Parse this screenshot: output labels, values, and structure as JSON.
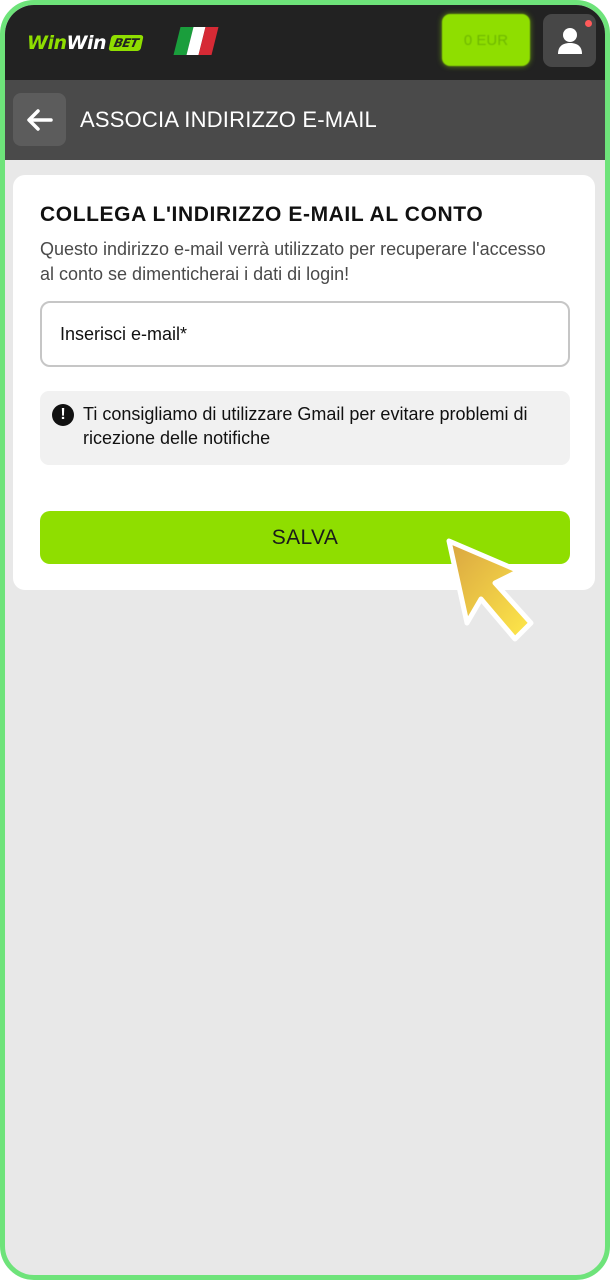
{
  "header": {
    "logo": {
      "part1": "Win",
      "part2": "Win",
      "badge": "BET"
    },
    "balance_label": "0 EUR",
    "flag_colors": [
      "#1a9e3c",
      "#ffffff",
      "#d62a35"
    ],
    "accent_color": "#8fde00"
  },
  "subheader": {
    "title": "ASSOCIA INDIRIZZO E-MAIL"
  },
  "card": {
    "title": "COLLEGA L'INDIRIZZO E-MAIL AL CONTO",
    "description": "Questo indirizzo e-mail verrà utilizzato per recuperare l'accesso al conto se dimenticherai i dati di login!",
    "email_placeholder": "Inserisci e-mail*",
    "notice": "Ti consigliamo di utilizzare Gmail per evitare problemi di ricezione delle notifiche",
    "save_label": "SALVA"
  },
  "icons": {
    "back": "arrow-left-icon",
    "profile": "user-icon",
    "notice": "exclamation-icon"
  }
}
